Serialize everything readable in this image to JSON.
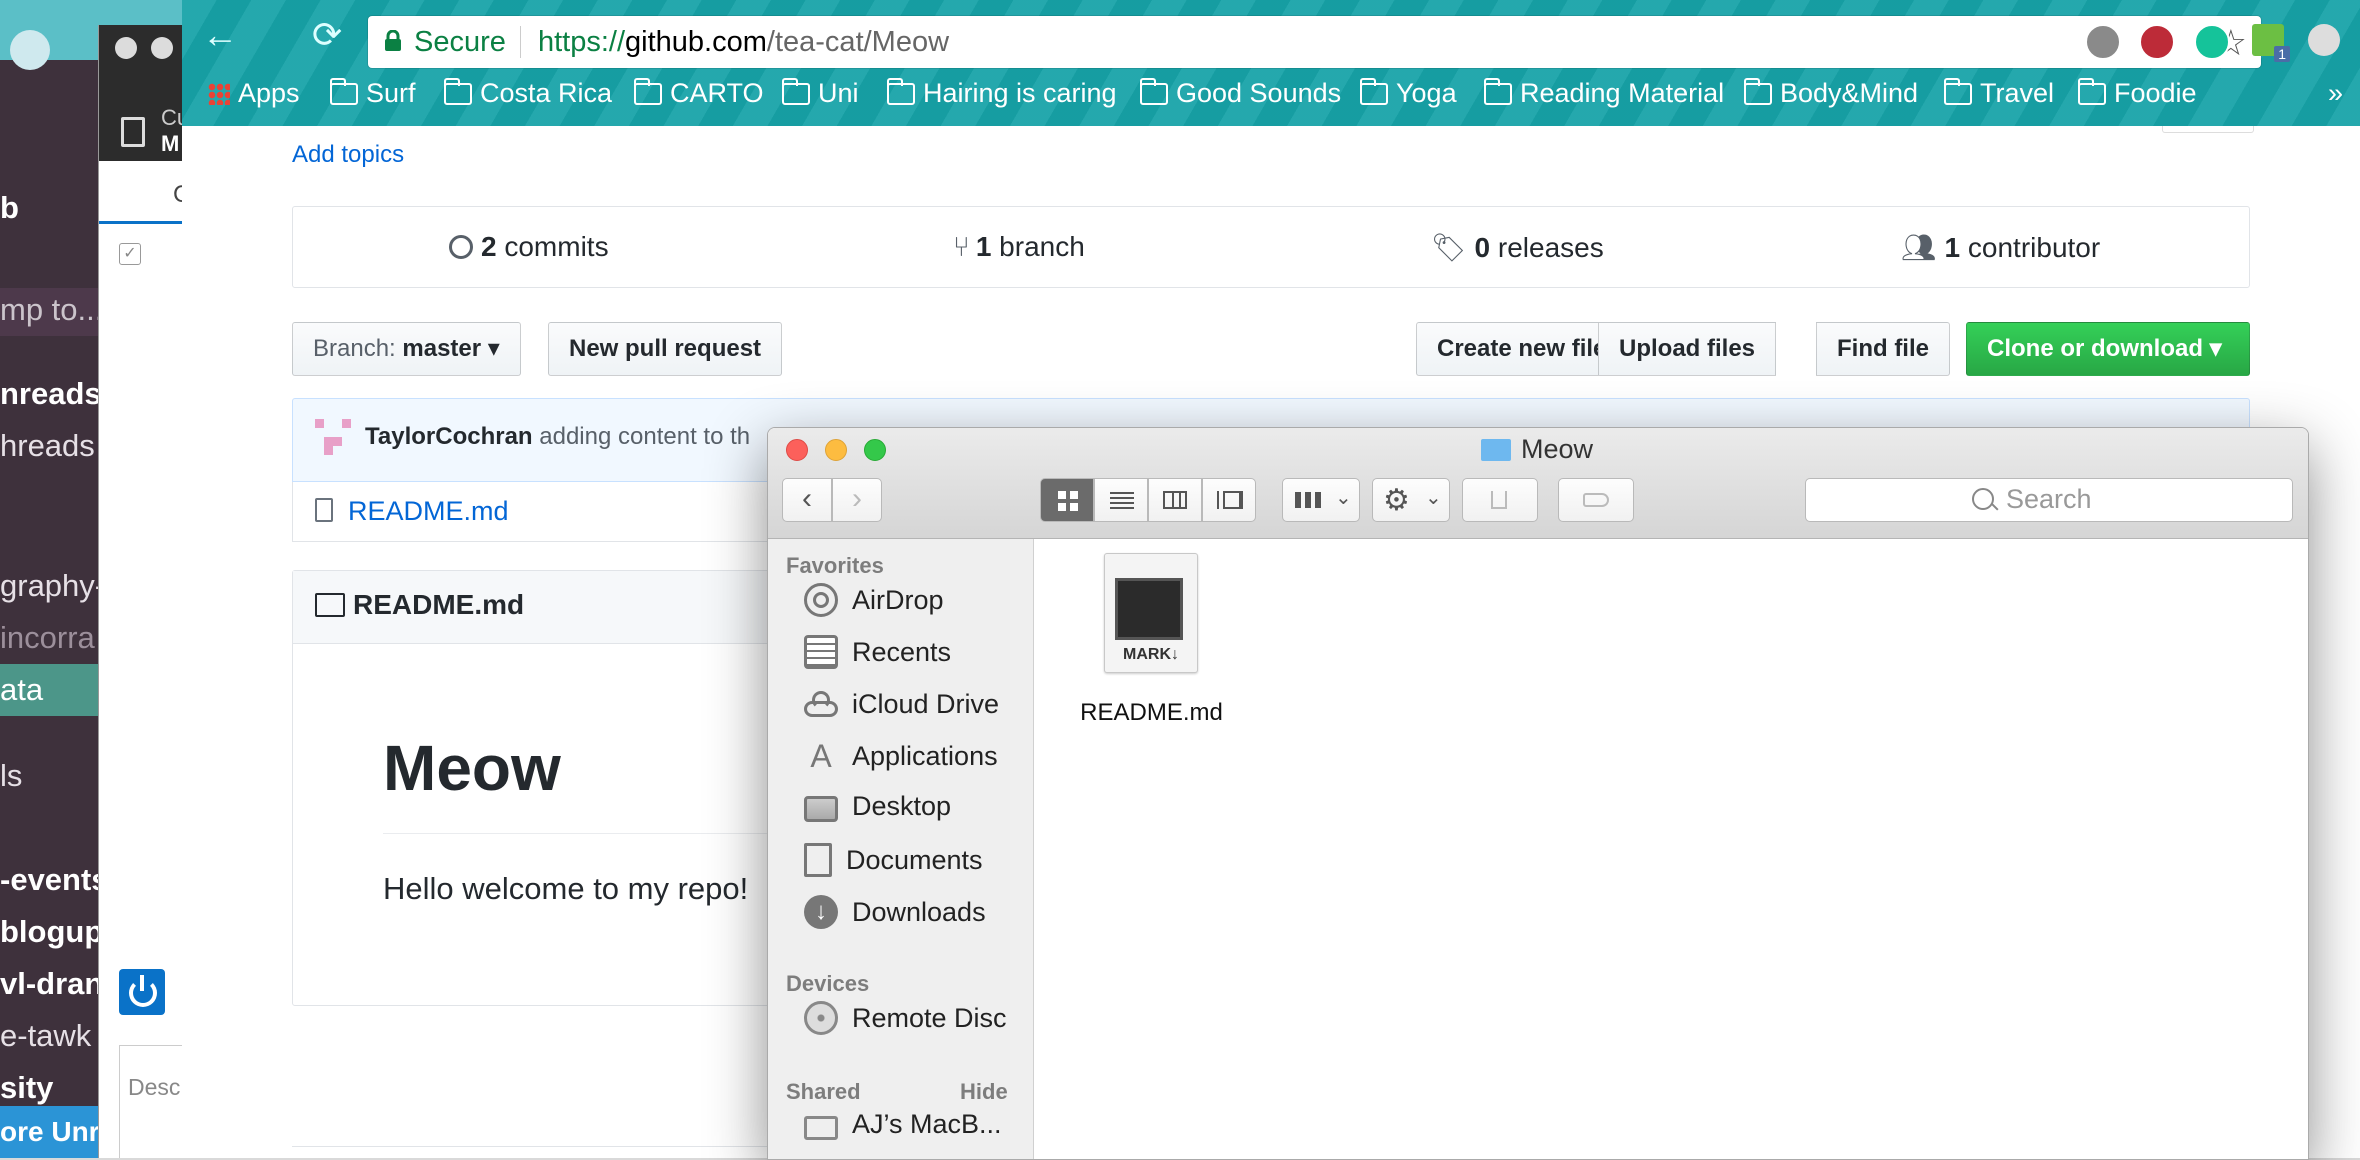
{
  "slack": {
    "channels": [
      "b",
      "mp to...",
      "nreads",
      "hreads",
      "graphy-",
      "incorra",
      "ata",
      "ls",
      "-events",
      "blogup",
      "vl-dran",
      "e-tawk",
      "sity"
    ],
    "unread_banner": "ore Unre"
  },
  "mid_window": {
    "title_fragment1": "Cu",
    "title_fragment2": "M",
    "tab_fragment": "C",
    "desc_fragment": "Desc"
  },
  "chrome": {
    "secure_label": "Secure",
    "url_scheme": "https://",
    "url_host": "github.com",
    "url_path": "/tea-cat/Meow",
    "bookmarks": [
      "Apps",
      "Surf",
      "Costa Rica",
      "CARTO",
      "Uni",
      "Hairing is caring",
      "Good Sounds",
      "Yoga",
      "Reading Material",
      "Body&Mind",
      "Travel",
      "Foodie"
    ],
    "more": "»",
    "ext_badge": "1"
  },
  "repo": {
    "add_topics": "Add topics",
    "commits_count": "2",
    "commits_label": "commits",
    "branches_count": "1",
    "branches_label": "branch",
    "releases_count": "0",
    "releases_label": "releases",
    "contributors_count": "1",
    "contributors_label": "contributor",
    "branch_prefix": "Branch:",
    "branch_name": "master",
    "new_pull_request": "New pull request",
    "create_new_file": "Create new file",
    "upload_files": "Upload files",
    "find_file": "Find file",
    "clone_or_download": "Clone or download",
    "commit_author": "TaylorCochran",
    "commit_message": "adding content to th",
    "file_name": "README.md",
    "readme_header": "README.md",
    "readme_title": "Meow",
    "readme_body": "Hello welcome to my repo!"
  },
  "finder": {
    "title": "Meow",
    "search_placeholder": "Search",
    "favorites_heading": "Favorites",
    "favorites": [
      {
        "label": "AirDrop",
        "icon": "airdrop-icon"
      },
      {
        "label": "Recents",
        "icon": "recents-icon"
      },
      {
        "label": "iCloud Drive",
        "icon": "cloud-icon"
      },
      {
        "label": "Applications",
        "icon": "applications-icon"
      },
      {
        "label": "Desktop",
        "icon": "desktop-icon"
      },
      {
        "label": "Documents",
        "icon": "documents-icon"
      },
      {
        "label": "Downloads",
        "icon": "downloads-icon"
      }
    ],
    "devices_heading": "Devices",
    "devices": [
      {
        "label": "Remote Disc",
        "icon": "disc-icon"
      }
    ],
    "shared_heading": "Shared",
    "shared_hide": "Hide",
    "shared": [
      {
        "label": "AJ’s MacB...",
        "icon": "computer-icon"
      }
    ],
    "file": {
      "name": "README.md",
      "icon_caption": "MARK↓"
    }
  }
}
